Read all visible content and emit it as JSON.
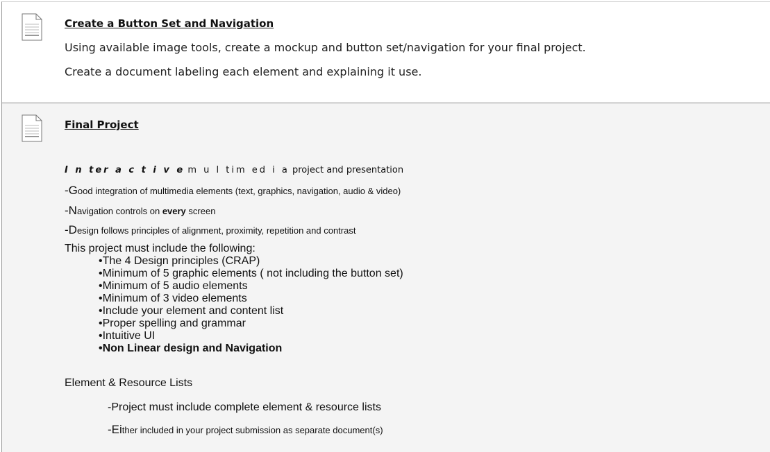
{
  "items": [
    {
      "title": "Create a Button Set and Navigation",
      "lines": [
        "Using available image tools, create a mockup and button set/navigation for your final project.",
        "Create a document labeling each element and explaining it use."
      ]
    },
    {
      "title": "Final Project",
      "intro": {
        "bold_part": "Interactive",
        "thin_part": "multimedia",
        "rest": " project and presentation",
        "display_bold": "I n ter a c t i v e",
        "display_thin": "m u l tim ed i a"
      },
      "dash_lines": [
        {
          "lead": "-G",
          "text": "ood integration of multimedia elements (text, graphics, navigation, audio & video)"
        },
        {
          "lead": "-N",
          "text": "avigation controls on ",
          "bold": "every",
          "after": " screen"
        },
        {
          "lead": "-D",
          "text": "esign follows principles of alignment, proximity, repetition and contrast"
        }
      ],
      "requirements_heading": "This project must include the following:",
      "requirements": [
        "•The 4 Design principles (CRAP)",
        "•Minimum of 5 graphic elements ( not including the button set)",
        "•Minimum of 5 audio elements",
        "•Minimum of 3 video elements",
        "•Include your element and content list",
        "•Proper spelling and grammar",
        "•Intuitive UI",
        "•Non Linear design and Navigation"
      ],
      "lists_heading": "Element & Resource Lists",
      "lists_lines": [
        {
          "lead": "-Project must include complete element & resource lists",
          "rest": ""
        },
        {
          "lead": "-Ei",
          "rest": "ther included in your project submission as separate document(s)"
        }
      ]
    }
  ]
}
